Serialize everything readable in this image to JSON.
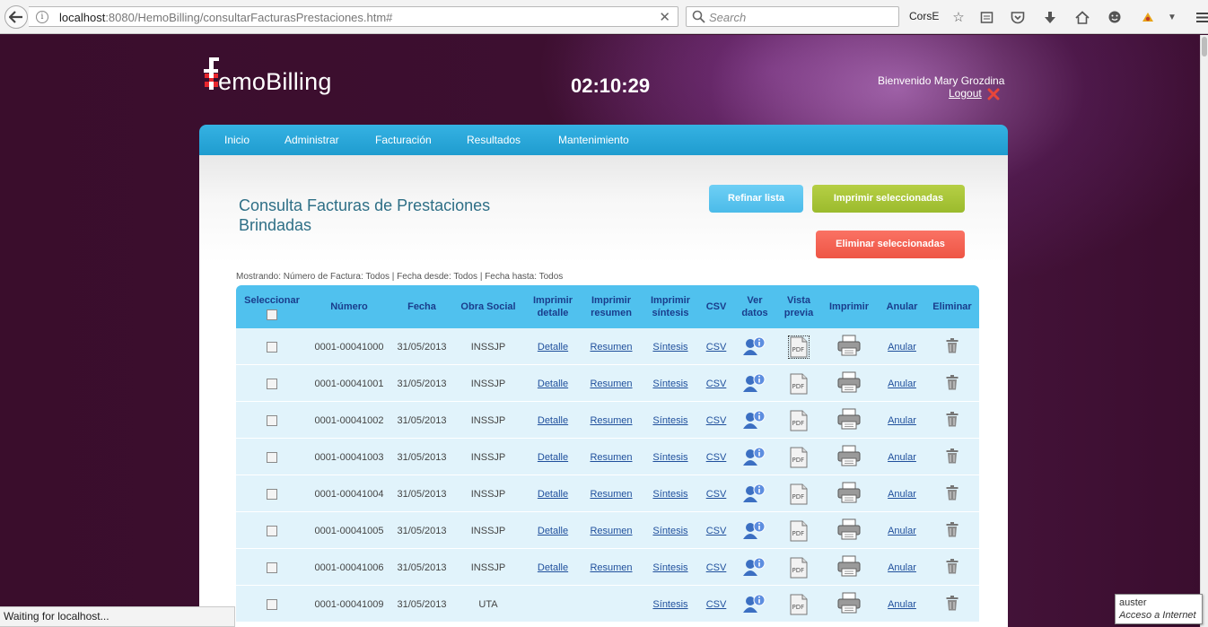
{
  "browser": {
    "url_host": "localhost",
    "url_rest": ":8080/HemoBilling/consultarFacturasPrestaciones.htm#",
    "search_placeholder": "Search",
    "cors_label": "CorsE",
    "status_text": "Waiting for localhost..."
  },
  "header": {
    "logo_text": "emoBilling",
    "clock": "02:10:29",
    "welcome": "Bienvenido Mary Grozdina",
    "logout": "Logout"
  },
  "nav": {
    "items": [
      "Inicio",
      "Administrar",
      "Facturación",
      "Resultados",
      "Mantenimiento"
    ]
  },
  "content": {
    "title": "Consulta Facturas de Prestaciones Brindadas",
    "refine_button": "Refinar lista",
    "print_selected_button": "Imprimir seleccionadas",
    "delete_selected_button": "Eliminar seleccionadas",
    "filters": "Mostrando: Número de Factura: Todos | Fecha desde: Todos | Fecha hasta: Todos"
  },
  "table": {
    "headers": {
      "select": "Seleccionar",
      "number": "Número",
      "date": "Fecha",
      "insurance": "Obra Social",
      "print_detail": [
        "Imprimir",
        "detalle"
      ],
      "print_summary": [
        "Imprimir",
        "resumen"
      ],
      "print_synthesis": [
        "Imprimir",
        "síntesis"
      ],
      "csv": "CSV",
      "view_data": [
        "Ver",
        "datos"
      ],
      "preview": [
        "Vista",
        "previa"
      ],
      "print": "Imprimir",
      "cancel": "Anular",
      "delete": "Eliminar"
    },
    "rows": [
      {
        "number": "0001-00041000",
        "date": "31/05/2013",
        "insurance": "INSSJP",
        "detail": "Detalle",
        "summary": "Resumen",
        "synthesis": "Síntesis",
        "csv": "CSV",
        "cancel": "Anular"
      },
      {
        "number": "0001-00041001",
        "date": "31/05/2013",
        "insurance": "INSSJP",
        "detail": "Detalle",
        "summary": "Resumen",
        "synthesis": "Síntesis",
        "csv": "CSV",
        "cancel": "Anular"
      },
      {
        "number": "0001-00041002",
        "date": "31/05/2013",
        "insurance": "INSSJP",
        "detail": "Detalle",
        "summary": "Resumen",
        "synthesis": "Síntesis",
        "csv": "CSV",
        "cancel": "Anular"
      },
      {
        "number": "0001-00041003",
        "date": "31/05/2013",
        "insurance": "INSSJP",
        "detail": "Detalle",
        "summary": "Resumen",
        "synthesis": "Síntesis",
        "csv": "CSV",
        "cancel": "Anular"
      },
      {
        "number": "0001-00041004",
        "date": "31/05/2013",
        "insurance": "INSSJP",
        "detail": "Detalle",
        "summary": "Resumen",
        "synthesis": "Síntesis",
        "csv": "CSV",
        "cancel": "Anular"
      },
      {
        "number": "0001-00041005",
        "date": "31/05/2013",
        "insurance": "INSSJP",
        "detail": "Detalle",
        "summary": "Resumen",
        "synthesis": "Síntesis",
        "csv": "CSV",
        "cancel": "Anular"
      },
      {
        "number": "0001-00041006",
        "date": "31/05/2013",
        "insurance": "INSSJP",
        "detail": "Detalle",
        "summary": "Resumen",
        "synthesis": "Síntesis",
        "csv": "CSV",
        "cancel": "Anular"
      },
      {
        "number": "0001-00041009",
        "date": "31/05/2013",
        "insurance": "UTA",
        "detail": "",
        "summary": "",
        "synthesis": "Síntesis",
        "csv": "CSV",
        "cancel": "Anular"
      }
    ]
  },
  "tooltip": {
    "line1": "auster",
    "line2": "Acceso a Internet"
  },
  "colors": {
    "nav": "#1f9ccf",
    "title": "#2e6f86",
    "table_header": "#50c1ee",
    "row": "#e1f3fb",
    "refine": "#4bbbe9",
    "print_selected": "#9bbb2d",
    "delete_selected": "#ee5545"
  }
}
